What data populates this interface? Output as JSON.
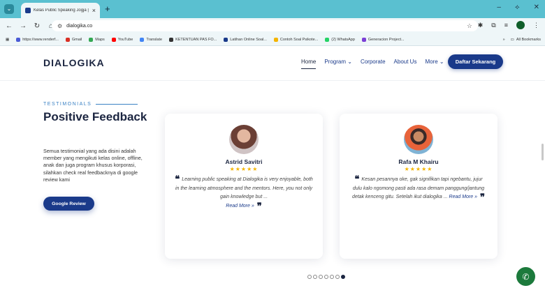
{
  "browser": {
    "tab_title": "Kelas Public Speaking Jogja | Di",
    "tab_close": "×",
    "new_tab": "+",
    "tab_menu": "⌄",
    "window_controls": [
      "–",
      "⟡",
      "✕"
    ],
    "url": "dialogika.co",
    "bookmarks": [
      {
        "label": "https://www.renderf...",
        "color": "#4a5bd6"
      },
      {
        "label": "Gmail",
        "color": "#d93025"
      },
      {
        "label": "Maps",
        "color": "#34a853"
      },
      {
        "label": "YouTube",
        "color": "#ff0000"
      },
      {
        "label": "Translate",
        "color": "#4285f4"
      },
      {
        "label": "KETENTUAN PAS FO...",
        "color": "#333333"
      },
      {
        "label": "Latihan Online Soal...",
        "color": "#1a3a8a"
      },
      {
        "label": "Contoh Soal Psikote...",
        "color": "#f4b400"
      },
      {
        "label": "(2) WhatsApp",
        "color": "#25d366"
      },
      {
        "label": "Generacion Project...",
        "color": "#7b3fd6"
      }
    ],
    "bookmarks_more": "»",
    "all_bookmarks": "All Bookmarks"
  },
  "site": {
    "logo": "DIALOGIKA",
    "nav": [
      {
        "label": "Home",
        "active": true
      },
      {
        "label": "Program ⌄",
        "active": false
      },
      {
        "label": "Corporate",
        "active": false
      },
      {
        "label": "About Us",
        "active": false
      },
      {
        "label": "More ⌄",
        "active": false
      }
    ],
    "cta": "Daftar Sekarang"
  },
  "testimonials": {
    "eyebrow": "TESTIMONIALS",
    "headline": "Positive Feedback",
    "description": "Semua testimonial yang ada disini adalah member yang mengikuti kelas online, offline, anak dan juga program khusus korporasi, silahkan check real feedbacknya di google review kami",
    "button": "Google Review",
    "cards": [
      {
        "name": "Astrid Savitri",
        "stars": "★★★★★",
        "quote": "Learning public speaking at Dialogika is very enjoyable, both in the learning atmosphere and the mentors. Here, you not only gain knowledge but ...",
        "more": "Read More »"
      },
      {
        "name": "Rafa M Khairu",
        "stars": "★★★★★",
        "quote": "Kesan pesannya oke, gak signifikan tapi ngebantu, jujur dulu kalo ngomong pasti ada rasa demam panggung/jantung detak kenceng gitu. Setelah ikut dialogika ...",
        "more": "Read More »"
      }
    ],
    "pagination": {
      "total": 7,
      "active": 7
    }
  },
  "colors": {
    "brand": "#1a3a8a",
    "accent": "#3b82c4",
    "tabbar": "#5ac0d0"
  }
}
